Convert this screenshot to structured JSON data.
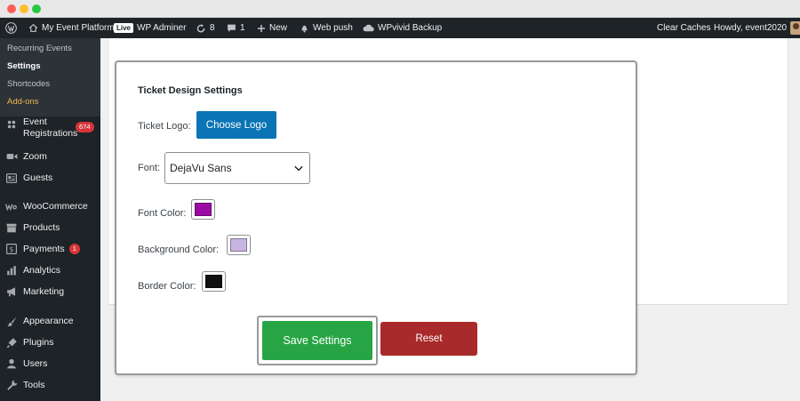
{
  "admin_bar": {
    "site_name": "My Event Platform",
    "live_badge": "Live",
    "site_label": "WP Adminer",
    "updates_count": "8",
    "comments_count": "1",
    "new_label": "New",
    "web_push_label": "Web push",
    "backup_label": "WPvivid Backup",
    "clear_caches_label": "Clear Caches",
    "howdy_label": "Howdy, event2020"
  },
  "sidebar": {
    "submenu": [
      "Recurring Events",
      "Settings",
      "Shortcodes",
      "Add-ons"
    ],
    "items": [
      {
        "label": "Event Registrations",
        "badge": "674",
        "icon": "calendar-icon"
      },
      {
        "label": "Zoom",
        "icon": "video-icon"
      },
      {
        "label": "Guests",
        "icon": "id-card-icon"
      },
      {
        "label": "WooCommerce",
        "icon": "woo-icon"
      },
      {
        "label": "Products",
        "icon": "archive-icon"
      },
      {
        "label": "Payments",
        "badge": "1",
        "icon": "dollar-icon"
      },
      {
        "label": "Analytics",
        "icon": "bar-chart-icon"
      },
      {
        "label": "Marketing",
        "icon": "megaphone-icon"
      },
      {
        "label": "Appearance",
        "icon": "brush-icon"
      },
      {
        "label": "Plugins",
        "icon": "plugin-icon"
      },
      {
        "label": "Users",
        "icon": "user-icon"
      },
      {
        "label": "Tools",
        "icon": "wrench-icon"
      }
    ]
  },
  "settings": {
    "title": "Ticket Design Settings",
    "logo_label": "Ticket Logo:",
    "choose_logo_button": "Choose Logo",
    "font_label": "Font:",
    "font_value": "DejaVu Sans",
    "font_color_label": "Font Color:",
    "font_color": "#9b0aa5",
    "background_color_label": "Background Color:",
    "background_color": "#c8b4e0",
    "border_color_label": "Border Color:",
    "border_color": "#111111",
    "save_button": "Save Settings",
    "reset_button": "Reset"
  }
}
